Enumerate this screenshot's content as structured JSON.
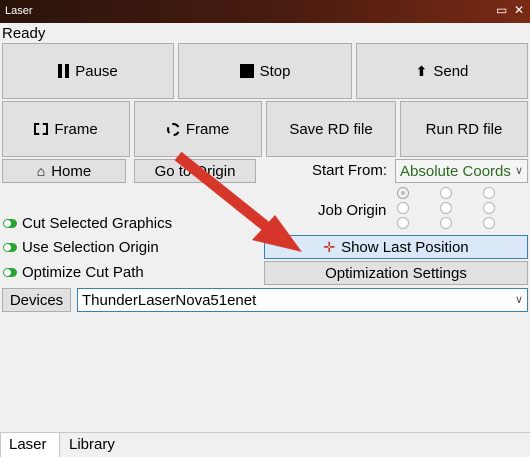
{
  "window": {
    "title": "Laser",
    "restore_icon": "restore-icon",
    "close_icon": "close-icon"
  },
  "status": "Ready",
  "toolbar": {
    "pause": "Pause",
    "stop": "Stop",
    "send": "Send",
    "frame_rect": "Frame",
    "frame_circle": "Frame",
    "save_rd": "Save RD file",
    "run_rd": "Run RD file",
    "home": "Home",
    "go_to_origin": "Go to Origin"
  },
  "start_from": {
    "label": "Start From:",
    "value": "Absolute Coords"
  },
  "job_origin": {
    "label": "Job Origin",
    "selected_index": 0
  },
  "options": {
    "cut_selected": "Cut Selected Graphics",
    "use_selection_origin": "Use Selection Origin",
    "optimize_cut_path": "Optimize Cut Path"
  },
  "buttons": {
    "show_last_position": "Show Last Position",
    "optimization_settings": "Optimization Settings"
  },
  "devices": {
    "label": "Devices",
    "value": "ThunderLaserNova51enet"
  },
  "tabs": [
    {
      "label": "Laser",
      "active": true
    },
    {
      "label": "Library",
      "active": false
    }
  ],
  "colors": {
    "arrow": "#d7372a",
    "toggle_on": "#2aa535",
    "highlight_border": "#3c7fb1"
  }
}
